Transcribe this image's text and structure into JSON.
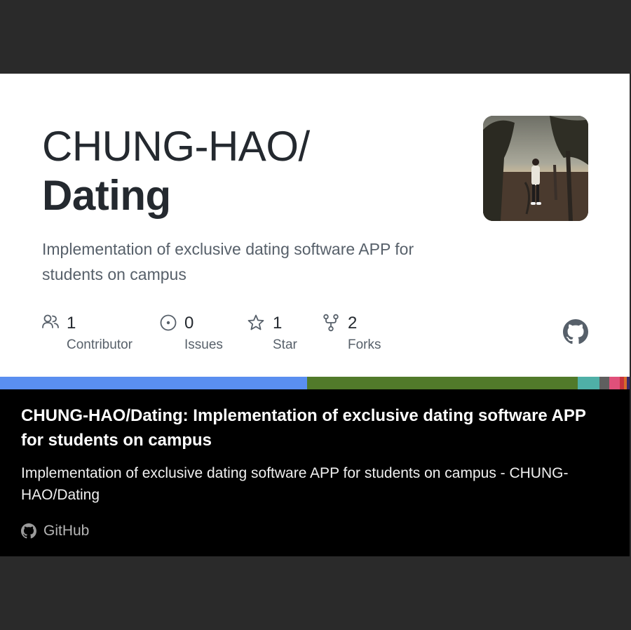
{
  "repo": {
    "owner": "CHUNG-HAO/",
    "name": "Dating",
    "description": "Implementation of exclusive dating software APP for students on campus"
  },
  "stats": [
    {
      "icon": "people-icon",
      "count": "1",
      "label": "Contributor"
    },
    {
      "icon": "issue-icon",
      "count": "0",
      "label": "Issues"
    },
    {
      "icon": "star-icon",
      "count": "1",
      "label": "Star"
    },
    {
      "icon": "fork-icon",
      "count": "2",
      "label": "Forks"
    }
  ],
  "language_bar": [
    {
      "color": "#5a8ff0",
      "share": 0.488
    },
    {
      "color": "#517a2a",
      "share": 0.43
    },
    {
      "color": "#4fb0a7",
      "share": 0.034
    },
    {
      "color": "#5f5f5f",
      "share": 0.016
    },
    {
      "color": "#e0507a",
      "share": 0.016
    },
    {
      "color": "#c8323c",
      "share": 0.007
    },
    {
      "color": "#d86a2a",
      "share": 0.004
    },
    {
      "color": "#3a2a6a",
      "share": 0.005
    }
  ],
  "link_preview": {
    "title": "CHUNG-HAO/Dating: Implementation of exclusive dating software APP for students on campus",
    "description": "Implementation of exclusive dating software APP for students on campus - CHUNG-HAO/Dating",
    "site": "GitHub"
  }
}
